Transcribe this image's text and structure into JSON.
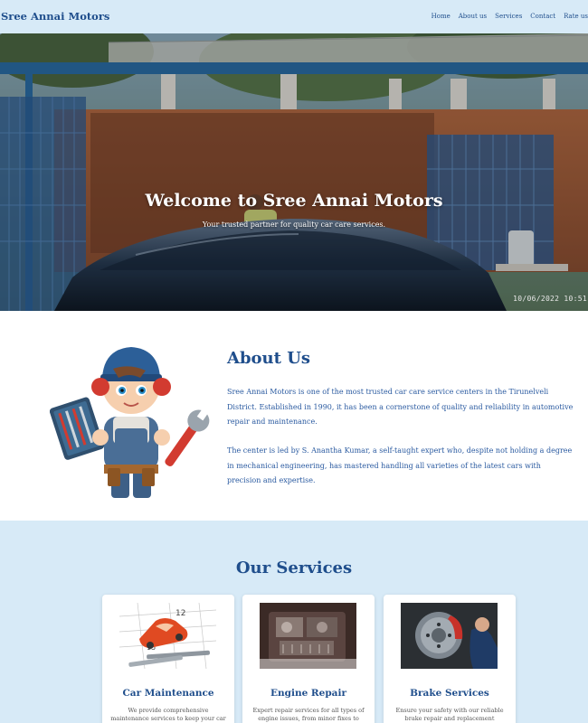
{
  "header": {
    "brand": "Sree Annai Motors",
    "nav": [
      "Home",
      "About us",
      "Services",
      "Contact",
      "Rate us"
    ]
  },
  "hero": {
    "title": "Welcome to Sree Annai Motors",
    "subtitle": "Your trusted partner for quality car care services.",
    "timestamp": "10/06/2022 10:51"
  },
  "about": {
    "title": "About Us",
    "paragraph1": "Sree Annai Motors is one of the most trusted car care service centers in the Tirunelveli District. Established in 1990, it has been a cornerstone of quality and reliability in automotive repair and maintenance.",
    "paragraph2": "The center is led by S. Anantha Kumar, a self-taught expert who, despite not holding a degree in mechanical engineering, has mastered handling all varieties of the latest cars with precision and expertise."
  },
  "services": {
    "title": "Our Services",
    "cards": [
      {
        "title": "Car Maintenance",
        "text": "We provide comprehensive maintenance services to keep your car"
      },
      {
        "title": "Engine Repair",
        "text": "Expert repair services for all types of engine issues, from minor fixes to"
      },
      {
        "title": "Brake Services",
        "text": "Ensure your safety with our reliable brake repair and replacement"
      }
    ]
  },
  "colors": {
    "header_bg": "#d7eaf7",
    "brand_blue": "#1f4e8c",
    "services_bg": "#d7eaf7"
  }
}
